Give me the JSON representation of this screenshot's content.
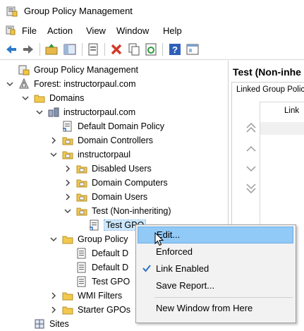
{
  "window": {
    "title": "Group Policy Management"
  },
  "menubar": {
    "items": [
      "File",
      "Action",
      "View",
      "Window",
      "Help"
    ]
  },
  "toolbar": {
    "buttons": [
      "back-icon",
      "forward-icon",
      "up-folder-icon",
      "show-hide-tree-icon",
      "properties-icon",
      "delete-icon",
      "copy-icon",
      "refresh-icon",
      "help-icon",
      "console-icon"
    ]
  },
  "tree": {
    "items": [
      {
        "label": "Group Policy Management",
        "icon": "gpm-icon",
        "chev": "none"
      },
      {
        "label": "Forest: instructorpaul.com",
        "icon": "forest-icon",
        "chev": "down"
      },
      {
        "label": "Domains",
        "icon": "folder-icon",
        "chev": "down"
      },
      {
        "label": "instructorpaul.com",
        "icon": "domain-icon",
        "chev": "down"
      },
      {
        "label": "Default Domain Policy",
        "icon": "gpo-link-icon",
        "chev": "none"
      },
      {
        "label": "Domain Controllers",
        "icon": "ou-icon",
        "chev": "right"
      },
      {
        "label": "instructorpaul",
        "icon": "ou-icon",
        "chev": "down"
      },
      {
        "label": "Disabled Users",
        "icon": "ou-icon",
        "chev": "right"
      },
      {
        "label": "Domain Computers",
        "icon": "ou-icon",
        "chev": "right"
      },
      {
        "label": "Domain Users",
        "icon": "ou-icon",
        "chev": "right"
      },
      {
        "label": "Test (Non-inheriting)",
        "icon": "ou-icon",
        "chev": "down"
      },
      {
        "label": "Test GPO",
        "icon": "gpo-link-icon",
        "chev": "none",
        "selected": true
      },
      {
        "label": "Group Policy",
        "icon": "folder-icon",
        "chev": "down"
      },
      {
        "label": "Default D",
        "icon": "gpo-icon",
        "chev": "none"
      },
      {
        "label": "Default D",
        "icon": "gpo-icon",
        "chev": "none"
      },
      {
        "label": "Test GPO",
        "icon": "gpo-icon",
        "chev": "none"
      },
      {
        "label": "WMI Filters",
        "icon": "folder-icon",
        "chev": "right"
      },
      {
        "label": "Starter GPOs",
        "icon": "folder-icon",
        "chev": "right"
      },
      {
        "label": "Sites",
        "icon": "sites-icon",
        "chev": "none"
      }
    ]
  },
  "right_pane": {
    "title": "Test (Non-inhe",
    "tab": "Linked Group Polic",
    "column": "Link"
  },
  "context_menu": {
    "items": [
      {
        "label": "Edit...",
        "highlighted": true
      },
      {
        "label": "Enforced"
      },
      {
        "label": "Link Enabled",
        "checked": true
      },
      {
        "label": "Save Report..."
      },
      {
        "label": "New Window from Here"
      }
    ]
  }
}
